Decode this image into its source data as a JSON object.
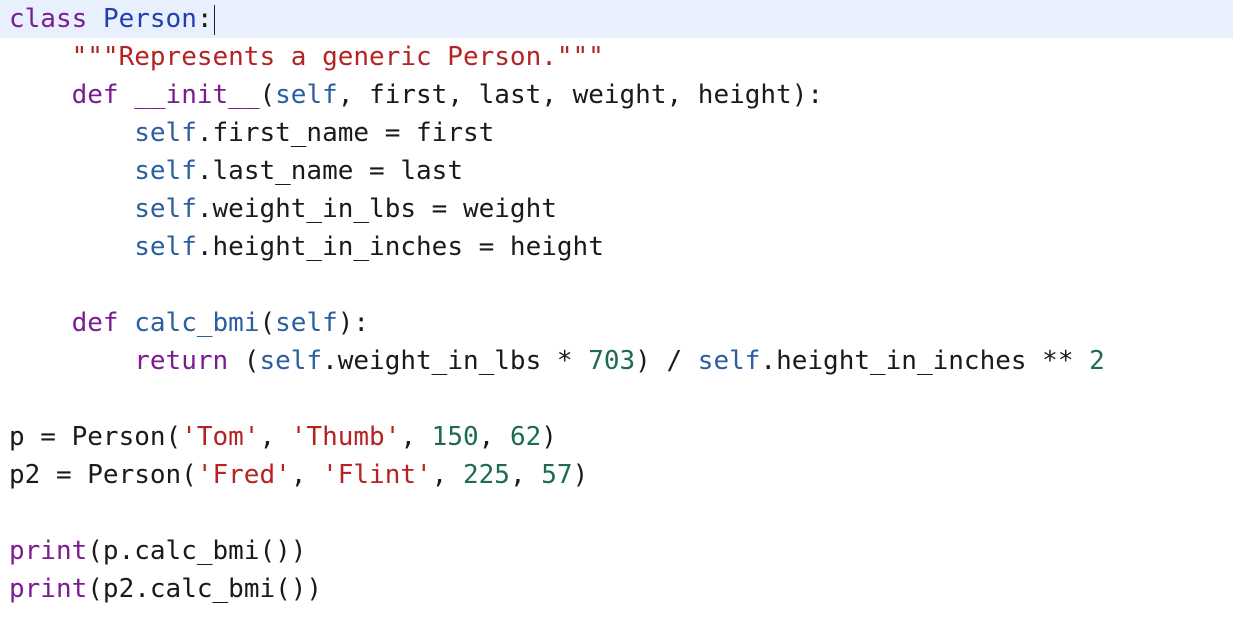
{
  "colors": {
    "keyword": "#7b1c92",
    "classname": "#1f3fb0",
    "self": "#2b5fa0",
    "string": "#b52323",
    "number": "#1c6b55",
    "plain": "#1a1a1a",
    "current_line_bg": "#e8f0fd"
  },
  "editor": {
    "current_line": 1,
    "lines": [
      [
        {
          "t": "class",
          "k": "keyword"
        },
        {
          "t": " ",
          "k": "plain"
        },
        {
          "t": "Person",
          "k": "classname"
        },
        {
          "t": ":",
          "k": "plain"
        }
      ],
      [
        {
          "t": "    ",
          "k": "plain"
        },
        {
          "t": "\"\"\"Represents a generic Person.\"\"\"",
          "k": "string"
        }
      ],
      [
        {
          "t": "    ",
          "k": "plain"
        },
        {
          "t": "def",
          "k": "keyword"
        },
        {
          "t": " ",
          "k": "plain"
        },
        {
          "t": "__init__",
          "k": "keyword"
        },
        {
          "t": "(",
          "k": "plain"
        },
        {
          "t": "self",
          "k": "self"
        },
        {
          "t": ", first, last, weight, height):",
          "k": "plain"
        }
      ],
      [
        {
          "t": "        ",
          "k": "plain"
        },
        {
          "t": "self",
          "k": "self"
        },
        {
          "t": ".first_name = first",
          "k": "plain"
        }
      ],
      [
        {
          "t": "        ",
          "k": "plain"
        },
        {
          "t": "self",
          "k": "self"
        },
        {
          "t": ".last_name = last",
          "k": "plain"
        }
      ],
      [
        {
          "t": "        ",
          "k": "plain"
        },
        {
          "t": "self",
          "k": "self"
        },
        {
          "t": ".weight_in_lbs = weight",
          "k": "plain"
        }
      ],
      [
        {
          "t": "        ",
          "k": "plain"
        },
        {
          "t": "self",
          "k": "self"
        },
        {
          "t": ".height_in_inches = height",
          "k": "plain"
        }
      ],
      [],
      [
        {
          "t": "    ",
          "k": "plain"
        },
        {
          "t": "def",
          "k": "keyword"
        },
        {
          "t": " ",
          "k": "plain"
        },
        {
          "t": "calc_bmi",
          "k": "self"
        },
        {
          "t": "(",
          "k": "plain"
        },
        {
          "t": "self",
          "k": "self"
        },
        {
          "t": "):",
          "k": "plain"
        }
      ],
      [
        {
          "t": "        ",
          "k": "plain"
        },
        {
          "t": "return",
          "k": "keyword"
        },
        {
          "t": " (",
          "k": "plain"
        },
        {
          "t": "self",
          "k": "self"
        },
        {
          "t": ".weight_in_lbs * ",
          "k": "plain"
        },
        {
          "t": "703",
          "k": "number"
        },
        {
          "t": ") / ",
          "k": "plain"
        },
        {
          "t": "self",
          "k": "self"
        },
        {
          "t": ".height_in_inches ** ",
          "k": "plain"
        },
        {
          "t": "2",
          "k": "number"
        }
      ],
      [],
      [
        {
          "t": "p = Person(",
          "k": "plain"
        },
        {
          "t": "'Tom'",
          "k": "string"
        },
        {
          "t": ", ",
          "k": "plain"
        },
        {
          "t": "'Thumb'",
          "k": "string"
        },
        {
          "t": ", ",
          "k": "plain"
        },
        {
          "t": "150",
          "k": "number"
        },
        {
          "t": ", ",
          "k": "plain"
        },
        {
          "t": "62",
          "k": "number"
        },
        {
          "t": ")",
          "k": "plain"
        }
      ],
      [
        {
          "t": "p2 = Person(",
          "k": "plain"
        },
        {
          "t": "'Fred'",
          "k": "string"
        },
        {
          "t": ", ",
          "k": "plain"
        },
        {
          "t": "'Flint'",
          "k": "string"
        },
        {
          "t": ", ",
          "k": "plain"
        },
        {
          "t": "225",
          "k": "number"
        },
        {
          "t": ", ",
          "k": "plain"
        },
        {
          "t": "57",
          "k": "number"
        },
        {
          "t": ")",
          "k": "plain"
        }
      ],
      [],
      [
        {
          "t": "print",
          "k": "keyword"
        },
        {
          "t": "(p.calc_bmi())",
          "k": "plain"
        }
      ],
      [
        {
          "t": "print",
          "k": "keyword"
        },
        {
          "t": "(p2.calc_bmi())",
          "k": "plain"
        }
      ]
    ]
  }
}
